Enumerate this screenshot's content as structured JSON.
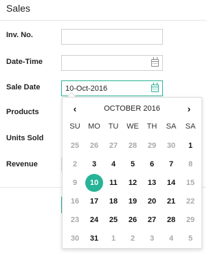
{
  "header": {
    "title": "Sales"
  },
  "form": {
    "inv_label": "Inv. No.",
    "inv_value": "",
    "datetime_label": "Date-Time",
    "datetime_value": "",
    "saledate_label": "Sale Date",
    "saledate_value": "10-Oct-2016",
    "products_label": "Products",
    "units_label": "Units Sold",
    "revenue_label": "Revenue"
  },
  "picker": {
    "prev": "‹",
    "next": "›",
    "month": "OCTOBER 2016",
    "dow": [
      "SU",
      "MO",
      "TU",
      "WE",
      "TH",
      "SA",
      "SA"
    ],
    "weeks": [
      [
        "25",
        "26",
        "27",
        "28",
        "29",
        "30",
        "1"
      ],
      [
        "2",
        "3",
        "4",
        "5",
        "6",
        "7",
        "8"
      ],
      [
        "9",
        "10",
        "11",
        "12",
        "13",
        "14",
        "15"
      ],
      [
        "16",
        "17",
        "18",
        "19",
        "20",
        "21",
        "22"
      ],
      [
        "23",
        "24",
        "25",
        "26",
        "27",
        "28",
        "29"
      ],
      [
        "30",
        "31",
        "1",
        "2",
        "3",
        "4",
        "5"
      ]
    ],
    "selected": "10",
    "accent": "#27b396"
  }
}
